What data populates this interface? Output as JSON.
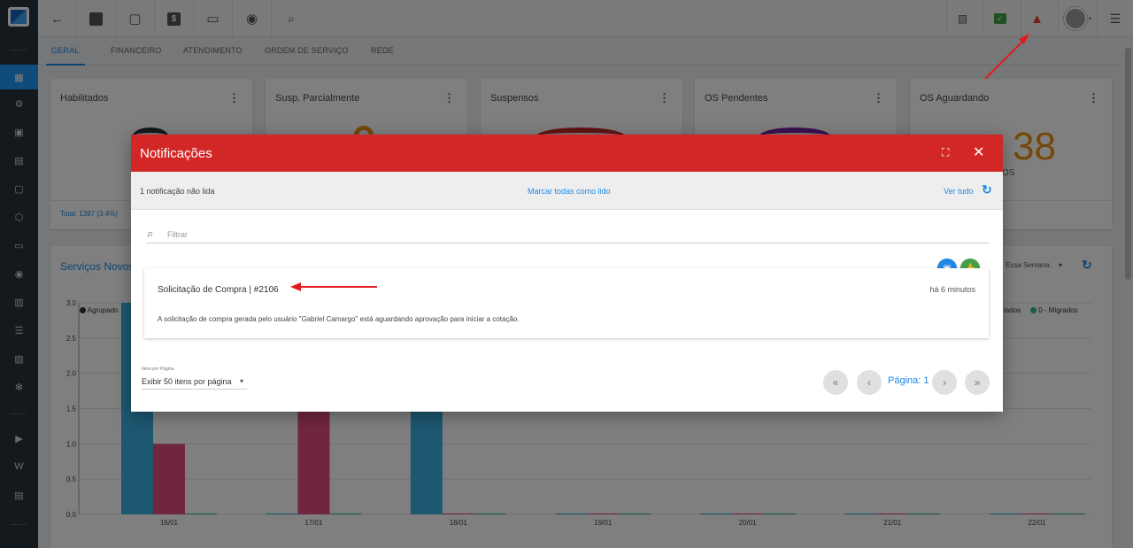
{
  "colors": {
    "accent": "#1e88e5",
    "header_red": "#d32727",
    "bar_blue": "#3aaee0",
    "bar_pink": "#e04c7c",
    "orange": "#e69312",
    "purple": "#7b1fa2"
  },
  "tabs": [
    "GERAL",
    "FINANCEIRO",
    "ATENDIMENTO",
    "ORDEM DE SERVIÇO",
    "REDE"
  ],
  "cards": [
    {
      "title": "Habilitados",
      "footer": "Total: 1397 (3.4%)"
    },
    {
      "title": "Susp. Parcialmente"
    },
    {
      "title": "Suspensos"
    },
    {
      "title": "OS Pendentes"
    },
    {
      "title": "OS Aguardando",
      "value": "38",
      "suffix": "OS"
    }
  ],
  "chart_panel": {
    "title": "Serviços Novos x",
    "period": "Essa Semana",
    "legend_left": "Agrupado",
    "legend_right": [
      "lados",
      "0 - Migrados"
    ]
  },
  "chart_data": {
    "type": "bar",
    "categories": [
      "16/01",
      "17/01",
      "18/01",
      "19/01",
      "20/01",
      "21/01",
      "22/01"
    ],
    "series": [
      {
        "name": "Agrupado",
        "color": "#3aaee0",
        "values": [
          3.0,
          0,
          3.0,
          0,
          0,
          0,
          0
        ]
      },
      {
        "color": "#e04c7c",
        "values": [
          1.0,
          3.0,
          0,
          0,
          0,
          0,
          0
        ]
      },
      {
        "color": "#2fbf7a",
        "values": [
          0,
          0,
          0,
          0,
          0,
          0,
          0
        ]
      }
    ],
    "yticks": [
      "0.0",
      "0.5",
      "1.0",
      "1.5",
      "2.0",
      "2.5",
      "3.0"
    ],
    "ylim": [
      0,
      3.0
    ]
  },
  "modal": {
    "title": "Notificações",
    "unread": "1 notificação não lida",
    "mark_all": "Marcar todas como lido",
    "see_all": "Ver tudo",
    "filter_placeholder": "Filtrar",
    "notification": {
      "title": "Solicitação de Compra | #2106",
      "time": "há 6 minutos",
      "body": "A solicitação de compra gerada pelo usuário \"Gabriel Camargo\" está aguardando aprovação para iniciar a cotação."
    },
    "per_page_label": "Itens por Página",
    "per_page_value": "Exibir 50 itens por página",
    "page_label": "Página: 1"
  }
}
